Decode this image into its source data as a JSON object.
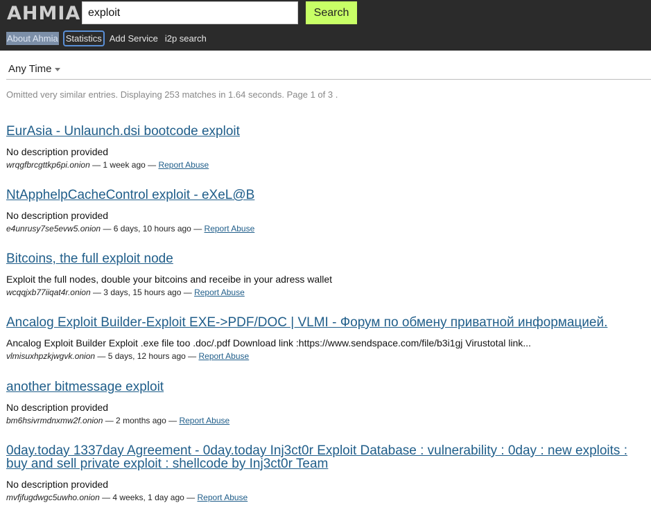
{
  "header": {
    "logo": "AHMIA",
    "search_value": "exploit",
    "search_button": "Search",
    "nav": [
      "About Ahmia",
      "Statistics",
      "Add Service",
      "i2p search"
    ]
  },
  "filter": {
    "label": "Any Time"
  },
  "stats_text": "Omitted very similar entries. Displaying 253 matches in 1.64 seconds. Page 1 of 3 .",
  "results": [
    {
      "title": "EurAsia - Unlaunch.dsi bootcode exploit",
      "description": "No description provided",
      "onion": "wrqgfbrcgttkp6pi.onion",
      "time": " — 1 week ago — ",
      "report": "Report Abuse"
    },
    {
      "title": "NtApphelpCacheControl exploit - eXeL@B",
      "description": "No description provided",
      "onion": "e4unrusy7se5evw5.onion",
      "time": " — 6 days, 10 hours ago — ",
      "report": "Report Abuse"
    },
    {
      "title": "Bitcoins, the full exploit node",
      "description": "Exploit the full nodes, double your bitcoins and receibe in your adress wallet",
      "onion": "wcqqjxb77iiqat4r.onion",
      "time": " — 3 days, 15 hours ago — ",
      "report": "Report Abuse"
    },
    {
      "title": "Ancalog Exploit Builder-Exploit EXE->PDF/DOC | VLMI - Форум по обмену приватной информацией.",
      "description": "Ancalog Exploit Builder Exploit .exe file too .doc/.pdf Download link :https://www.sendspace.com/file/b3i1gj Virustotal link...",
      "onion": "vlmisuxhpzkjwgvk.onion",
      "time": " — 5 days, 12 hours ago — ",
      "report": "Report Abuse"
    },
    {
      "title": "another bitmessage exploit",
      "description": "No description provided",
      "onion": "bm6hsivrmdnxmw2f.onion",
      "time": " — 2 months ago — ",
      "report": "Report Abuse"
    },
    {
      "title": "0day.today 1337day Agreement - 0day.today Inj3ct0r Exploit Database : vulnerability : 0day : new exploits : buy and sell private exploit : shellcode by Inj3ct0r Team",
      "description": "No description provided",
      "onion": "mvfjfugdwgc5uwho.onion",
      "time": " — 4 weeks, 1 day ago — ",
      "report": "Report Abuse"
    }
  ]
}
